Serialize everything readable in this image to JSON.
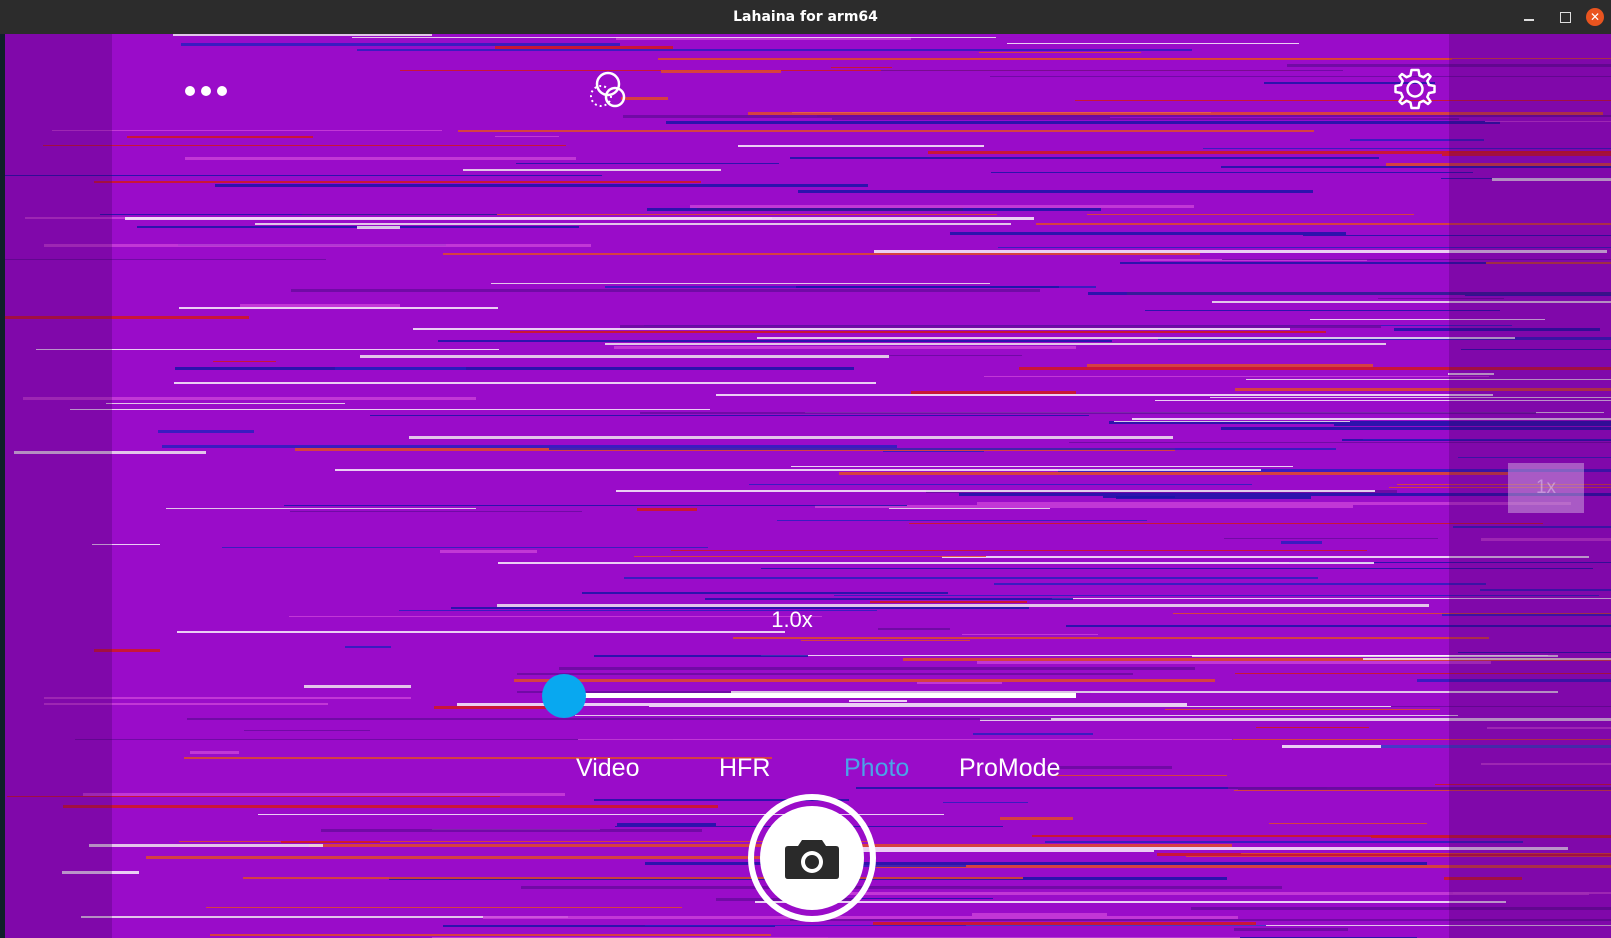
{
  "window": {
    "title": "Lahaina for arm64",
    "minimize_icon": "minimize-icon",
    "maximize_icon": "maximize-icon",
    "close_icon": "close-icon",
    "close_color": "#e9541f"
  },
  "camera": {
    "top_bar": {
      "more_icon": "more-dots-icon",
      "filter_icon": "filter-circles-icon",
      "settings_icon": "gear-icon"
    },
    "zoom_chip_label": "1x",
    "zoom_level": "1.0x",
    "zoom_slider_fraction": 0.0,
    "accent_color": "#08a8f0",
    "modes": [
      {
        "label": "Video",
        "selected": false
      },
      {
        "label": "HFR",
        "selected": false
      },
      {
        "label": "Photo",
        "selected": true
      },
      {
        "label": "ProMode",
        "selected": false
      }
    ],
    "selected_mode_color": "#4aa3e8",
    "shutter_icon": "camera-icon",
    "preview_background": "#9a0cc9"
  }
}
